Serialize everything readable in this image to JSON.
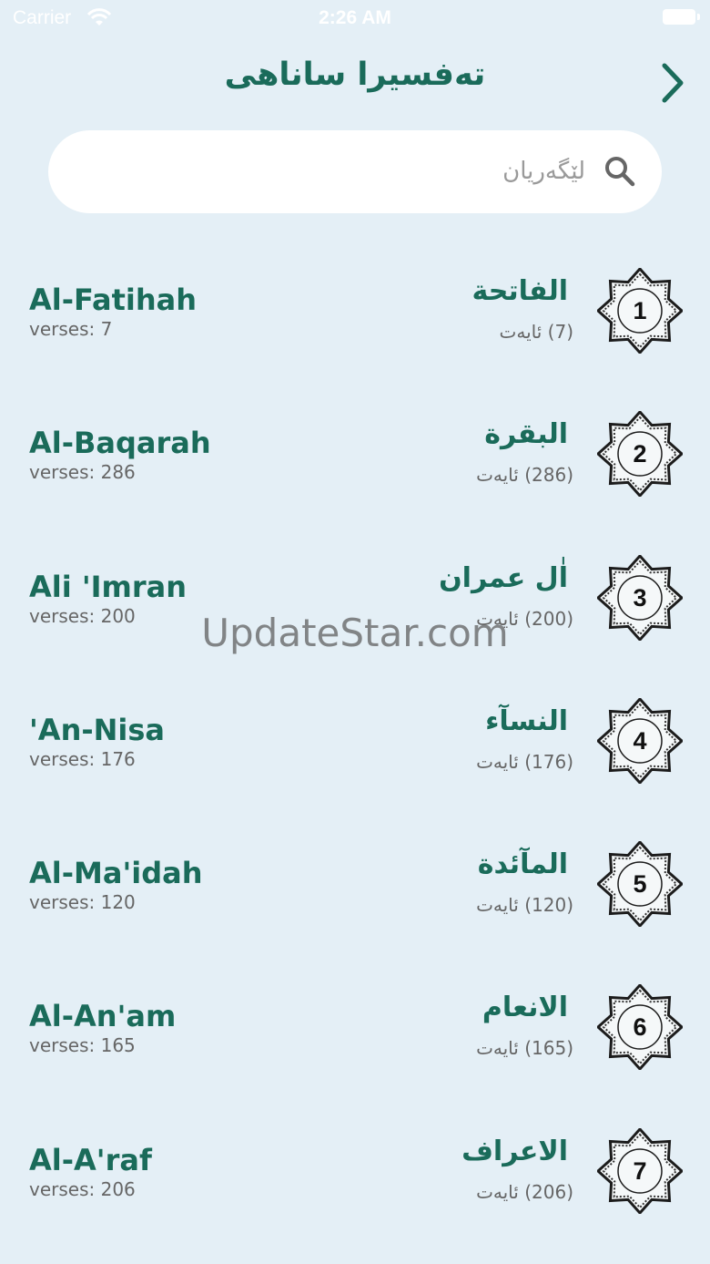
{
  "status_bar": {
    "carrier": "Carrier",
    "time": "2:26 AM"
  },
  "header": {
    "title": "تەفسیرا ساناهی",
    "back_icon": "chevron-right-icon"
  },
  "search": {
    "placeholder": "لێگەریان",
    "value": ""
  },
  "colors": {
    "background": "#e4eff6",
    "accent": "#1a6b5a"
  },
  "surahs": [
    {
      "number": "1",
      "arabic": "الفاتحة",
      "ayat": "(7) ئایەت",
      "english": "Al-Fatihah",
      "verses": "verses: 7"
    },
    {
      "number": "2",
      "arabic": "البقرة",
      "ayat": "(286) ئایەت",
      "english": "Al-Baqarah",
      "verses": "verses: 286"
    },
    {
      "number": "3",
      "arabic": "اٰل عمران",
      "ayat": "(200) ئایەت",
      "english": "Ali 'Imran",
      "verses": "verses: 200"
    },
    {
      "number": "4",
      "arabic": "النسآء",
      "ayat": "(176) ئایەت",
      "english": "'An-Nisa",
      "verses": "verses: 176"
    },
    {
      "number": "5",
      "arabic": "المآئدة",
      "ayat": "(120) ئایەت",
      "english": "Al-Ma'idah",
      "verses": "verses: 120"
    },
    {
      "number": "6",
      "arabic": "الانعام",
      "ayat": "(165) ئایەت",
      "english": "Al-An'am",
      "verses": "verses: 165"
    },
    {
      "number": "7",
      "arabic": "الاعراف",
      "ayat": "(206) ئایەت",
      "english": "Al-A'raf",
      "verses": "verses: 206"
    }
  ],
  "watermark": "UpdateStar.com"
}
